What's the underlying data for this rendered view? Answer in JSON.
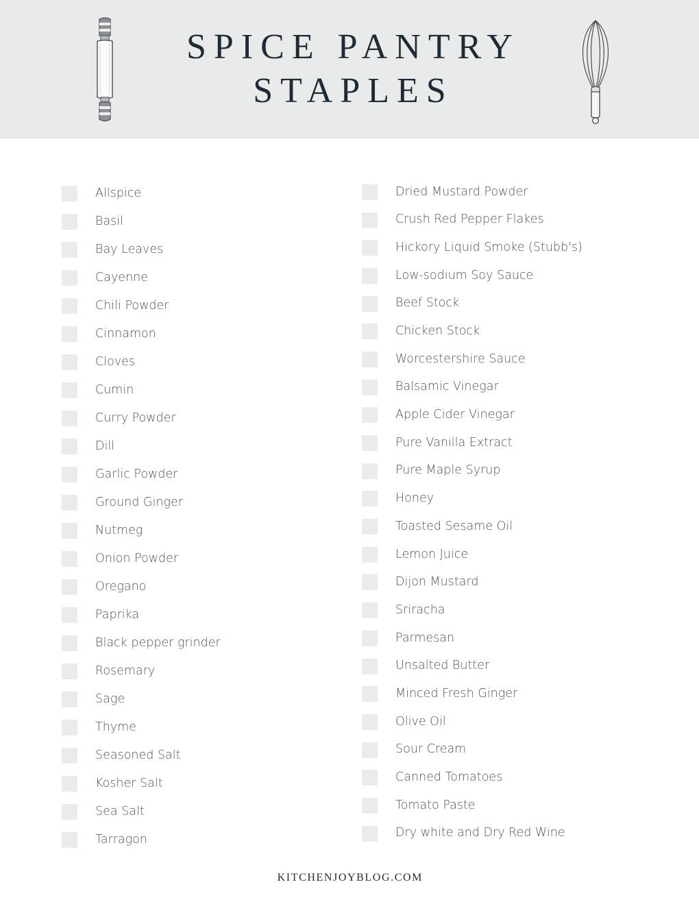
{
  "header": {
    "title_line1": "SPICE PANTRY",
    "title_line2": "STAPLES",
    "background_color": "#e9eaea",
    "title_color": "#1e2a34",
    "left_illustration": "rolling-pin-illustration",
    "right_illustration": "whisk-illustration"
  },
  "checklist": {
    "checkbox_color": "#ebebeb",
    "label_color": "#4c5661",
    "left_column": [
      {
        "label": "Allspice",
        "checked": false
      },
      {
        "label": "Basil",
        "checked": false
      },
      {
        "label": "Bay Leaves",
        "checked": false
      },
      {
        "label": "Cayenne",
        "checked": false
      },
      {
        "label": "Chili Powder",
        "checked": false
      },
      {
        "label": "Cinnamon",
        "checked": false
      },
      {
        "label": "Cloves",
        "checked": false
      },
      {
        "label": "Cumin",
        "checked": false
      },
      {
        "label": "Curry Powder",
        "checked": false
      },
      {
        "label": "Dill",
        "checked": false
      },
      {
        "label": "Garlic Powder",
        "checked": false
      },
      {
        "label": "Ground Ginger",
        "checked": false
      },
      {
        "label": "Nutmeg",
        "checked": false
      },
      {
        "label": "Onion Powder",
        "checked": false
      },
      {
        "label": "Oregano",
        "checked": false
      },
      {
        "label": "Paprika",
        "checked": false
      },
      {
        "label": "Black pepper grinder",
        "checked": false
      },
      {
        "label": "Rosemary",
        "checked": false
      },
      {
        "label": "Sage",
        "checked": false
      },
      {
        "label": "Thyme",
        "checked": false
      },
      {
        "label": "Seasoned Salt",
        "checked": false
      },
      {
        "label": "Kosher Salt",
        "checked": false
      },
      {
        "label": "Sea Salt",
        "checked": false
      },
      {
        "label": "Tarragon",
        "checked": false
      }
    ],
    "right_column": [
      {
        "label": "Dried Mustard Powder",
        "checked": false
      },
      {
        "label": "Crush Red Pepper Flakes",
        "checked": false
      },
      {
        "label": "Hickory Liquid Smoke (Stubb's)",
        "checked": false
      },
      {
        "label": "Low-sodium Soy Sauce",
        "checked": false
      },
      {
        "label": "Beef Stock",
        "checked": false
      },
      {
        "label": "Chicken Stock",
        "checked": false
      },
      {
        "label": "Worcestershire Sauce",
        "checked": false
      },
      {
        "label": "Balsamic Vinegar",
        "checked": false
      },
      {
        "label": "Apple Cider Vinegar",
        "checked": false
      },
      {
        "label": "Pure Vanilla Extract",
        "checked": false
      },
      {
        "label": "Pure Maple Syrup",
        "checked": false
      },
      {
        "label": "Honey",
        "checked": false
      },
      {
        "label": "Toasted Sesame Oil",
        "checked": false
      },
      {
        "label": "Lemon Juice",
        "checked": false
      },
      {
        "label": "Dijon Mustard",
        "checked": false
      },
      {
        "label": "Sriracha",
        "checked": false
      },
      {
        "label": "Parmesan",
        "checked": false
      },
      {
        "label": "Unsalted Butter",
        "checked": false
      },
      {
        "label": "Minced Fresh Ginger",
        "checked": false
      },
      {
        "label": "Olive Oil",
        "checked": false
      },
      {
        "label": "Sour Cream",
        "checked": false
      },
      {
        "label": "Canned Tomatoes",
        "checked": false
      },
      {
        "label": "Tomato Paste",
        "checked": false
      },
      {
        "label": "Dry white and Dry Red Wine",
        "checked": false
      }
    ]
  },
  "footer": {
    "site": "KITCHENJOYBLOG.COM"
  }
}
